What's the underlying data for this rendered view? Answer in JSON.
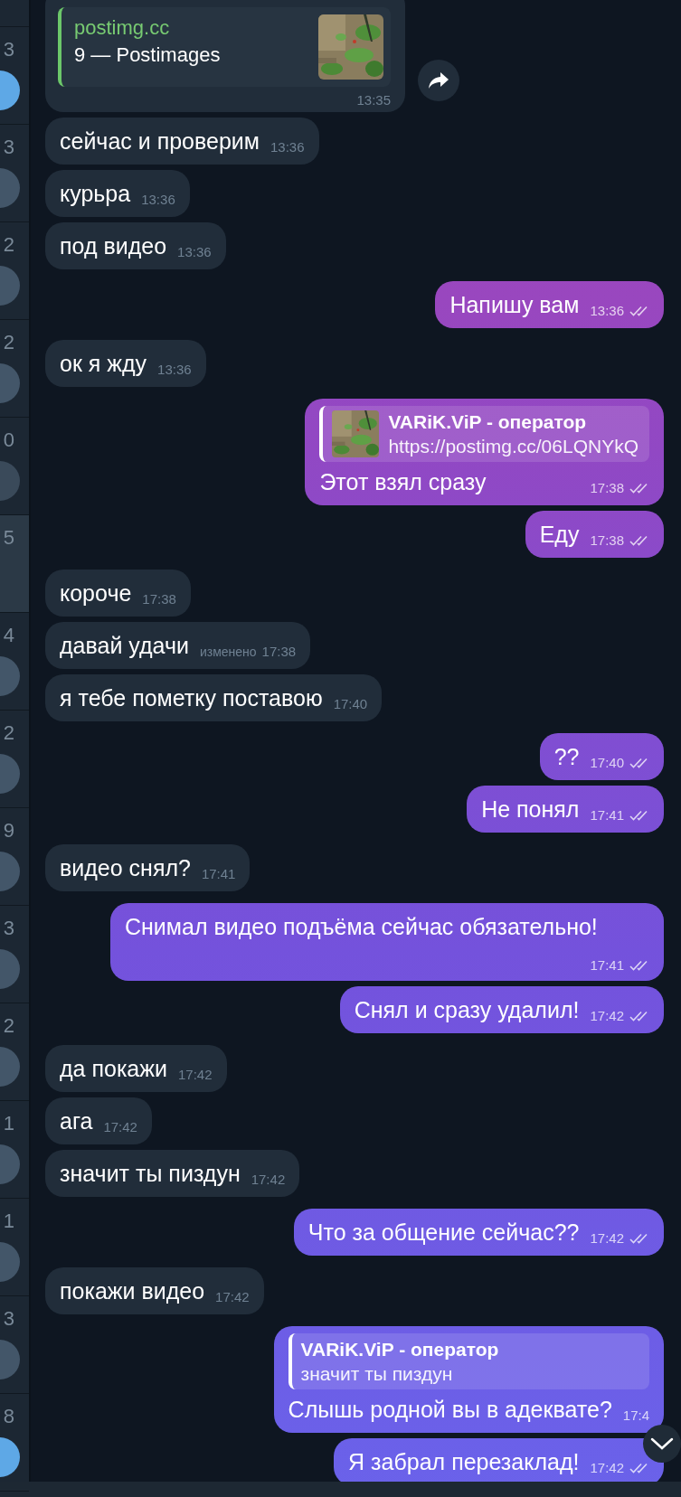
{
  "chat_list": [
    {
      "time_digit": "3",
      "color": "#5ea8e6",
      "selected": false
    },
    {
      "time_digit": "3",
      "color": "#435669",
      "selected": false
    },
    {
      "time_digit": "2",
      "color": "#435669",
      "selected": false
    },
    {
      "time_digit": "2",
      "color": "#435669",
      "selected": false
    },
    {
      "time_digit": "0",
      "color": "#3a4a5a",
      "selected": false
    },
    {
      "time_digit": "5",
      "selected": true
    },
    {
      "time_digit": "4",
      "color": "#435669",
      "selected": false
    },
    {
      "time_digit": "2",
      "color": "#435669",
      "selected": false
    },
    {
      "time_digit": "9",
      "color": "#435669",
      "selected": false
    },
    {
      "time_digit": "3",
      "color": "#435669",
      "selected": false
    },
    {
      "time_digit": "2",
      "color": "#435669",
      "selected": false
    },
    {
      "time_digit": "1",
      "color": "#435669",
      "selected": false
    },
    {
      "time_digit": "1",
      "color": "#435669",
      "selected": false
    },
    {
      "time_digit": "3",
      "color": "#435669",
      "selected": false
    },
    {
      "time_digit": "8",
      "color": "#5ea8e6",
      "selected": false
    }
  ],
  "messages": [
    {
      "kind": "link_preview",
      "outgoing": false,
      "site": "postimg.cc",
      "title": "9 — Postimages",
      "time": "13:35",
      "forward": true
    },
    {
      "kind": "text",
      "outgoing": false,
      "text": "сейчас и проверим",
      "time": "13:36"
    },
    {
      "kind": "text",
      "outgoing": false,
      "text": "курьра",
      "time": "13:36"
    },
    {
      "kind": "text",
      "outgoing": false,
      "text": "под видео",
      "time": "13:36"
    },
    {
      "kind": "text",
      "outgoing": true,
      "text": "Напишу вам",
      "time": "13:36",
      "read": true
    },
    {
      "kind": "text",
      "outgoing": false,
      "text": "ок я жду",
      "time": "13:36"
    },
    {
      "kind": "reply",
      "outgoing": true,
      "reply_author": "VARiK.ViP - оператор",
      "reply_text": "https://postimg.cc/06LQNYkQ",
      "reply_thumbnail": true,
      "text": "Этот взял сразу",
      "time": "17:38",
      "read": true
    },
    {
      "kind": "text",
      "outgoing": true,
      "text": "Еду",
      "time": "17:38",
      "read": true
    },
    {
      "kind": "text",
      "outgoing": false,
      "text": "короче",
      "time": "17:38"
    },
    {
      "kind": "text",
      "outgoing": false,
      "text": "давай удачи",
      "edited_label": "изменено",
      "time": "17:38"
    },
    {
      "kind": "text",
      "outgoing": false,
      "text": "я тебе пометку поставою",
      "time": "17:40"
    },
    {
      "kind": "text",
      "outgoing": true,
      "text": "??",
      "time": "17:40",
      "read": true
    },
    {
      "kind": "text",
      "outgoing": true,
      "text": "Не понял",
      "time": "17:41",
      "read": true
    },
    {
      "kind": "text",
      "outgoing": false,
      "text": "видео снял?",
      "time": "17:41"
    },
    {
      "kind": "text",
      "outgoing": true,
      "text": "Снимал видео подъёма сейчас обязательно!",
      "time": "17:41",
      "read": true
    },
    {
      "kind": "text",
      "outgoing": true,
      "text": "Снял и сразу удалил!",
      "time": "17:42",
      "read": true
    },
    {
      "kind": "text",
      "outgoing": false,
      "text": "да покажи",
      "time": "17:42"
    },
    {
      "kind": "text",
      "outgoing": false,
      "text": "ага",
      "time": "17:42"
    },
    {
      "kind": "text",
      "outgoing": false,
      "text": "значит ты пиздун",
      "time": "17:42"
    },
    {
      "kind": "text",
      "outgoing": true,
      "text": "Что за общение сейчас??",
      "time": "17:42",
      "read": true
    },
    {
      "kind": "text",
      "outgoing": false,
      "text": "покажи видео",
      "time": "17:42"
    },
    {
      "kind": "reply",
      "outgoing": true,
      "reply_author": "VARiK.ViP - оператор",
      "reply_text": "значит ты пиздун",
      "reply_thumbnail": false,
      "text": "Слышь родной вы в адеквате?",
      "time": "17:4"
    },
    {
      "kind": "text",
      "outgoing": true,
      "text": "Я забрал перезаклад!",
      "time": "17:42",
      "read": true
    }
  ],
  "scroll_down_button": true
}
